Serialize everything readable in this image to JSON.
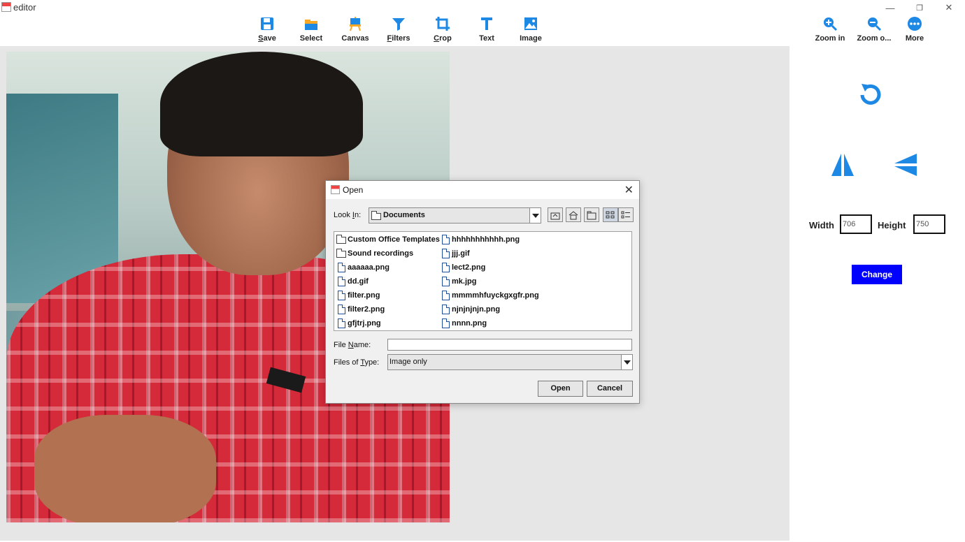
{
  "window": {
    "title": "editor",
    "controls": {
      "minimize": "—",
      "maximize": "❐",
      "close": "✕"
    }
  },
  "toolbar": {
    "tools": [
      {
        "label_u": "S",
        "label_rest": "ave",
        "icon": "save-icon"
      },
      {
        "label_u": "",
        "label_rest": "Select",
        "icon": "folder-open-icon"
      },
      {
        "label_u": "",
        "label_rest": "Canvas",
        "icon": "easel-icon"
      },
      {
        "label_u": "F",
        "label_rest": "ilters",
        "icon": "filter-icon"
      },
      {
        "label_u": "C",
        "label_rest": "rop",
        "icon": "crop-icon"
      },
      {
        "label_u": "",
        "label_rest": "Text",
        "icon": "text-icon"
      },
      {
        "label_u": "",
        "label_rest": "Image",
        "icon": "image-icon"
      }
    ],
    "right_tools": [
      {
        "label": "Zoom in",
        "icon": "zoom-in-icon"
      },
      {
        "label": "Zoom o...",
        "icon": "zoom-out-icon"
      },
      {
        "label": "More",
        "icon": "more-icon"
      }
    ]
  },
  "right_panel": {
    "width_label": "Width",
    "width_value": "706",
    "height_label": "Height",
    "height_value": "750",
    "change_label": "Change"
  },
  "open_dialog": {
    "title": "Open",
    "look_in_label_u": "I",
    "look_in_label_pre": "Look ",
    "look_in_label_post": "n:",
    "look_in_value": "Documents",
    "files_col1": [
      {
        "name": "Custom Office Templates",
        "type": "folder"
      },
      {
        "name": "Sound recordings",
        "type": "folder"
      },
      {
        "name": "aaaaaa.png",
        "type": "file"
      },
      {
        "name": "dd.gif",
        "type": "file"
      },
      {
        "name": "filter.png",
        "type": "file"
      },
      {
        "name": "filter2.png",
        "type": "file"
      },
      {
        "name": "gfjtrj.png",
        "type": "file"
      }
    ],
    "files_col2": [
      {
        "name": "hhhhhhhhhhh.png",
        "type": "file"
      },
      {
        "name": "jjj.gif",
        "type": "file"
      },
      {
        "name": "lect2.png",
        "type": "file"
      },
      {
        "name": "mk.jpg",
        "type": "file"
      },
      {
        "name": "mmmmhfuyckgxgfr.png",
        "type": "file"
      },
      {
        "name": "njnjnjnjn.png",
        "type": "file"
      },
      {
        "name": "nnnn.png",
        "type": "file"
      }
    ],
    "file_name_label_pre": "File ",
    "file_name_label_u": "N",
    "file_name_label_post": "ame:",
    "file_name_value": "",
    "files_of_type_label_pre": "Files of ",
    "files_of_type_label_u": "T",
    "files_of_type_label_post": "ype:",
    "files_of_type_value": "Image only",
    "open_label": "Open",
    "cancel_label": "Cancel"
  },
  "colors": {
    "icon_blue": "#1e88e5",
    "change_button": "#0000ff",
    "canvas_bg": "#e6e6e6"
  }
}
